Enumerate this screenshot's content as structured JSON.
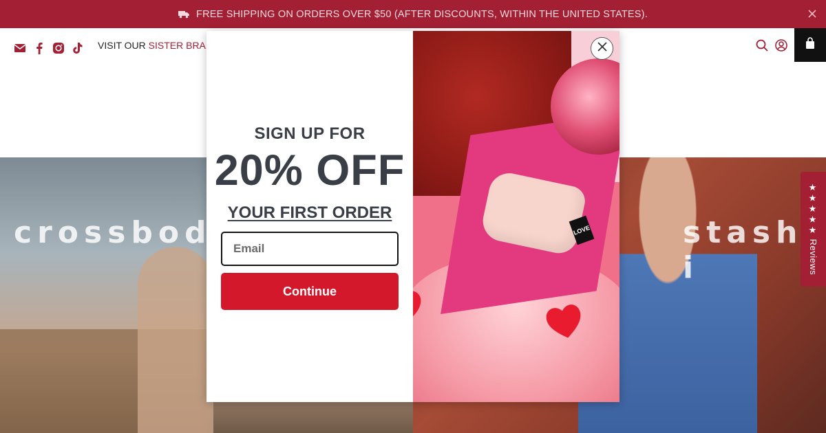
{
  "announcement": {
    "text": "FREE SHIPPING ON ORDERS OVER $50 (AFTER DISCOUNTS, WITHIN THE UNITED STATES).",
    "icon": "truck-icon",
    "close_icon": "close-icon"
  },
  "header": {
    "social_icons": [
      "email-icon",
      "facebook-icon",
      "instagram-icon",
      "tiktok-icon"
    ],
    "visit_prefix": "VISIT OUR",
    "visit_link": "SISTER BRAND",
    "right_icons": [
      "search-icon",
      "account-icon",
      "cart-icon"
    ]
  },
  "hero": {
    "left_title": "crossbody",
    "right_title": "stash i"
  },
  "reviews_tab": {
    "stars": "★★★★★",
    "label": "Reviews"
  },
  "modal": {
    "heading": "SIGN UP FOR",
    "offer": "20% OFF",
    "subheading": "YOUR FIRST ORDER",
    "email_placeholder": "Email",
    "continue_label": "Continue",
    "image_tag": "LOVE",
    "close_icon": "close-icon"
  },
  "colors": {
    "announcement_bg": "#a31f34",
    "button_bg": "#d3182b",
    "heading_text": "#3a3f47"
  }
}
